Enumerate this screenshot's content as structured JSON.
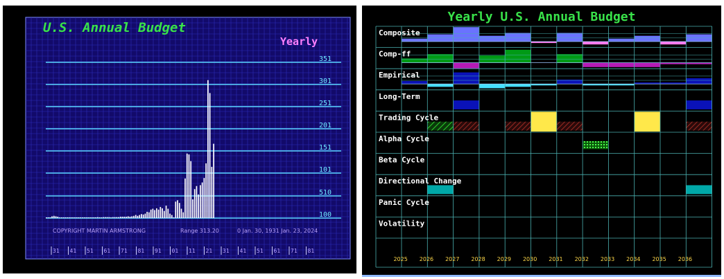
{
  "chart_data": [
    {
      "type": "bar",
      "title": "U.S. Annual Budget",
      "subtitle": "Yearly",
      "y_tick_labels": [
        "351",
        "301",
        "251",
        "201",
        "151",
        "101",
        "510",
        "100"
      ],
      "x_tick_labels": [
        "31",
        "41",
        "51",
        "61",
        "71",
        "81",
        "91",
        "01",
        "11",
        "21",
        "31",
        "41",
        "51",
        "61",
        "71",
        "81"
      ],
      "footer": {
        "copyright": "COPYRIGHT MARTIN ARMSTRONG",
        "range": "Range  313.20",
        "dates": "0  Jan. 30,   1931 Jan. 23,   2024"
      },
      "values": [
        1,
        1,
        1,
        4,
        5,
        4,
        3,
        1,
        1,
        1,
        1,
        1,
        1,
        1,
        1,
        1,
        1,
        1,
        1,
        1,
        1,
        1,
        1,
        1,
        1,
        1,
        1,
        2,
        1,
        1,
        2,
        2,
        2,
        2,
        1,
        2,
        2,
        2,
        2,
        3,
        3,
        3,
        3,
        4,
        3,
        4,
        5,
        7,
        5,
        7,
        9,
        8,
        10,
        14,
        13,
        19,
        21,
        18,
        22,
        19,
        25,
        22,
        16,
        28,
        21,
        10,
        7,
        1,
        37,
        40,
        34,
        21,
        13,
        89,
        145,
        143,
        128,
        42,
        65,
        72,
        53,
        74,
        80,
        90,
        123,
        310,
        281,
        115,
        167
      ],
      "ylim": [
        0,
        350
      ],
      "grid": true,
      "colors": {
        "background": "#000000",
        "plot": "#120a6a",
        "grid": "#2c2cb8",
        "hline": "#5ad6ff",
        "bar": "#ffffff",
        "title": "#39e24a",
        "subtitle": "#ff7fff",
        "tick": "#6fe8ff",
        "footer": "#b8a0ff",
        "frame": "#7d8cff"
      }
    },
    {
      "type": "table",
      "title": "Yearly U.S. Annual Budget",
      "columns": [
        "2025",
        "2026",
        "2027",
        "2028",
        "2029",
        "2030",
        "2031",
        "2032",
        "2033",
        "2034",
        "2035",
        "2036"
      ],
      "rows": [
        {
          "label": "Composite",
          "kind": "bars",
          "color": "#6a72ff",
          "neg": "#ff7af0",
          "values": [
            2,
            5,
            10,
            4,
            6,
            -1,
            6,
            -2,
            2,
            4,
            -2,
            5
          ]
        },
        {
          "label": "Comp-ff",
          "kind": "bars",
          "color": "#009a16",
          "neg": "#b51ab5",
          "values": [
            3,
            6,
            -4,
            5,
            9,
            0,
            6,
            -3,
            -3,
            -3,
            -1,
            -1
          ]
        },
        {
          "label": "Empirical",
          "kind": "bars",
          "color": "#0a12b8",
          "neg": "#45e0ff",
          "values": [
            2,
            -2,
            8,
            -3,
            -2,
            -1,
            3,
            -1,
            -1,
            1,
            1,
            4
          ]
        },
        {
          "label": "Long-Term",
          "kind": "cells",
          "cells": {
            "2027": "#0a12b8",
            "2036": "#0a12b8"
          }
        },
        {
          "label": "Trading Cycle",
          "kind": "cells",
          "cells": {
            "2026": "hatch-green",
            "2027": "hatch-red",
            "2029": "hatch-red",
            "2030": "#ffe84a",
            "2031": "hatch-red",
            "2034": "#ffe84a",
            "2036": "hatch-red"
          }
        },
        {
          "label": "Alpha Cycle",
          "kind": "cells",
          "cells": {
            "2032": "hatch-bright"
          }
        },
        {
          "label": "Beta Cycle",
          "kind": "cells",
          "cells": {}
        },
        {
          "label": "Directional Change",
          "kind": "cells",
          "cells": {
            "2026": "#00a8a8",
            "2036": "#00a8a8"
          }
        },
        {
          "label": "Panic Cycle",
          "kind": "cells",
          "cells": {}
        },
        {
          "label": "Volatility",
          "kind": "cells",
          "cells": {}
        }
      ],
      "colors": {
        "title": "#39e24a",
        "grid": "#4ab0b0",
        "label": "#ffffff",
        "year": "#ffd94a"
      }
    }
  ]
}
